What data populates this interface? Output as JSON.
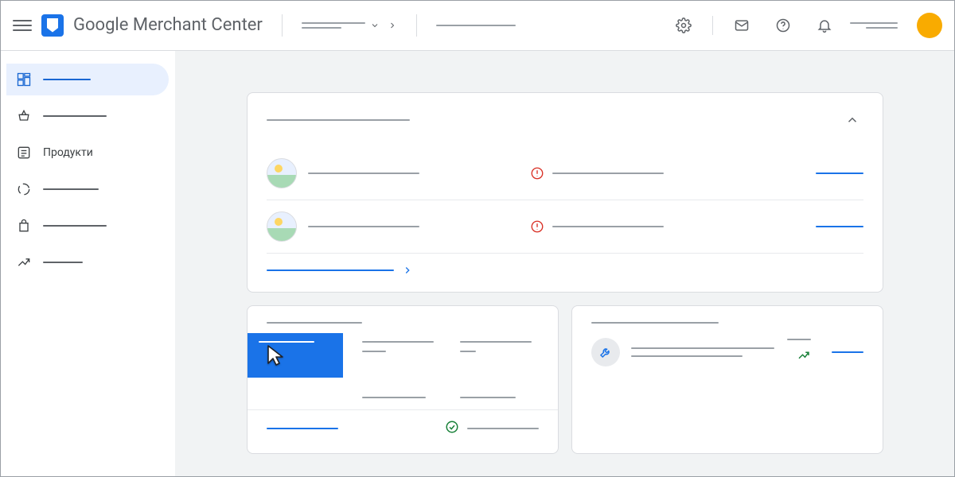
{
  "header": {
    "app_title": "Google Merchant Center"
  },
  "sidebar": {
    "items": [
      {
        "icon": "dashboard",
        "label": ""
      },
      {
        "icon": "basket",
        "label": ""
      },
      {
        "icon": "list",
        "label": "Продукти"
      },
      {
        "icon": "circle",
        "label": ""
      },
      {
        "icon": "bag",
        "label": ""
      },
      {
        "icon": "trend",
        "label": ""
      }
    ],
    "active_index": 0
  },
  "pending_tasks_card": {
    "rows": [
      {
        "status": "error"
      },
      {
        "status": "error"
      }
    ]
  },
  "colors": {
    "accent": "#1a73e8",
    "error": "#d93025",
    "success": "#188038",
    "avatar": "#f9ab00"
  }
}
